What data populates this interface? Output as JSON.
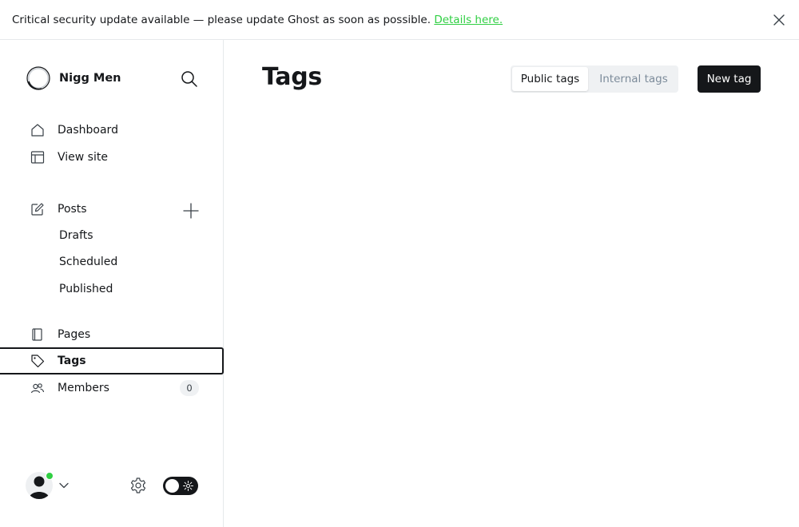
{
  "banner": {
    "message": "Critical security update available — please update Ghost as soon as possible.",
    "link_text": "Details here.",
    "close_icon": "close-icon"
  },
  "brand": {
    "site_name": "Nigg Men",
    "logo_icon": "site-logo-ring-icon",
    "search_icon": "search-icon"
  },
  "nav": {
    "dashboard": "Dashboard",
    "view_site": "View site",
    "posts": "Posts",
    "drafts": "Drafts",
    "scheduled": "Scheduled",
    "published": "Published",
    "pages": "Pages",
    "tags": "Tags",
    "members": "Members",
    "members_count": "0",
    "active": "tags"
  },
  "footer": {
    "avatar_icon": "user-avatar-icon",
    "status": "online",
    "settings_icon": "gear-icon",
    "theme_toggle": "dark-mode-toggle"
  },
  "main": {
    "title": "Tags",
    "tab_public": "Public tags",
    "tab_internal": "Internal tags",
    "selected_tab": "Public tags",
    "new_button": "New tag"
  },
  "colors": {
    "accent": "#30cf43",
    "dark": "#15171a",
    "muted": "#7c8b9a",
    "border": "#e6e9eb",
    "segment_bg": "#eff1f3"
  }
}
